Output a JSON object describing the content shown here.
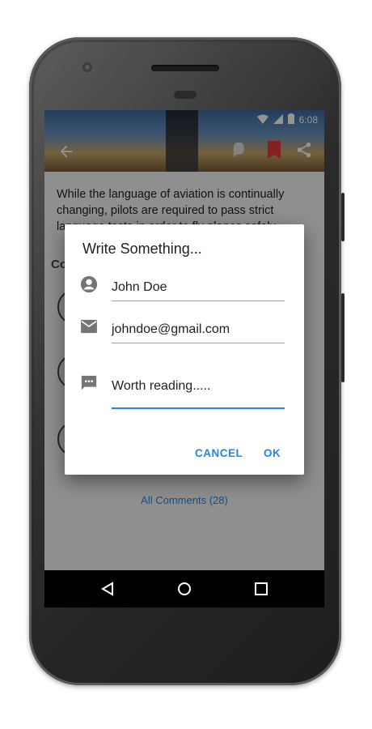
{
  "status_bar": {
    "time": "6:08"
  },
  "article": {
    "text": "While the language of aviation is continually changing, pilots are required to pass strict language tests in order to fly planes safely."
  },
  "comments": {
    "title_partial": "Co",
    "all_comments_label": "All Comments (28)"
  },
  "dialog": {
    "title": "Write Something...",
    "name_value": "John Doe",
    "email_value": "johndoe@gmail.com",
    "message_value": "Worth reading.....",
    "cancel_label": "CANCEL",
    "ok_label": "OK"
  },
  "icons": {
    "back": "arrow-back-icon",
    "profile": "person-icon",
    "email": "email-icon",
    "message": "message-icon",
    "fab": "chat-icon",
    "bookmark": "bookmark-icon",
    "share": "share-icon"
  },
  "colors": {
    "accent": "#1e88e5",
    "bookmark": "#e53935"
  }
}
